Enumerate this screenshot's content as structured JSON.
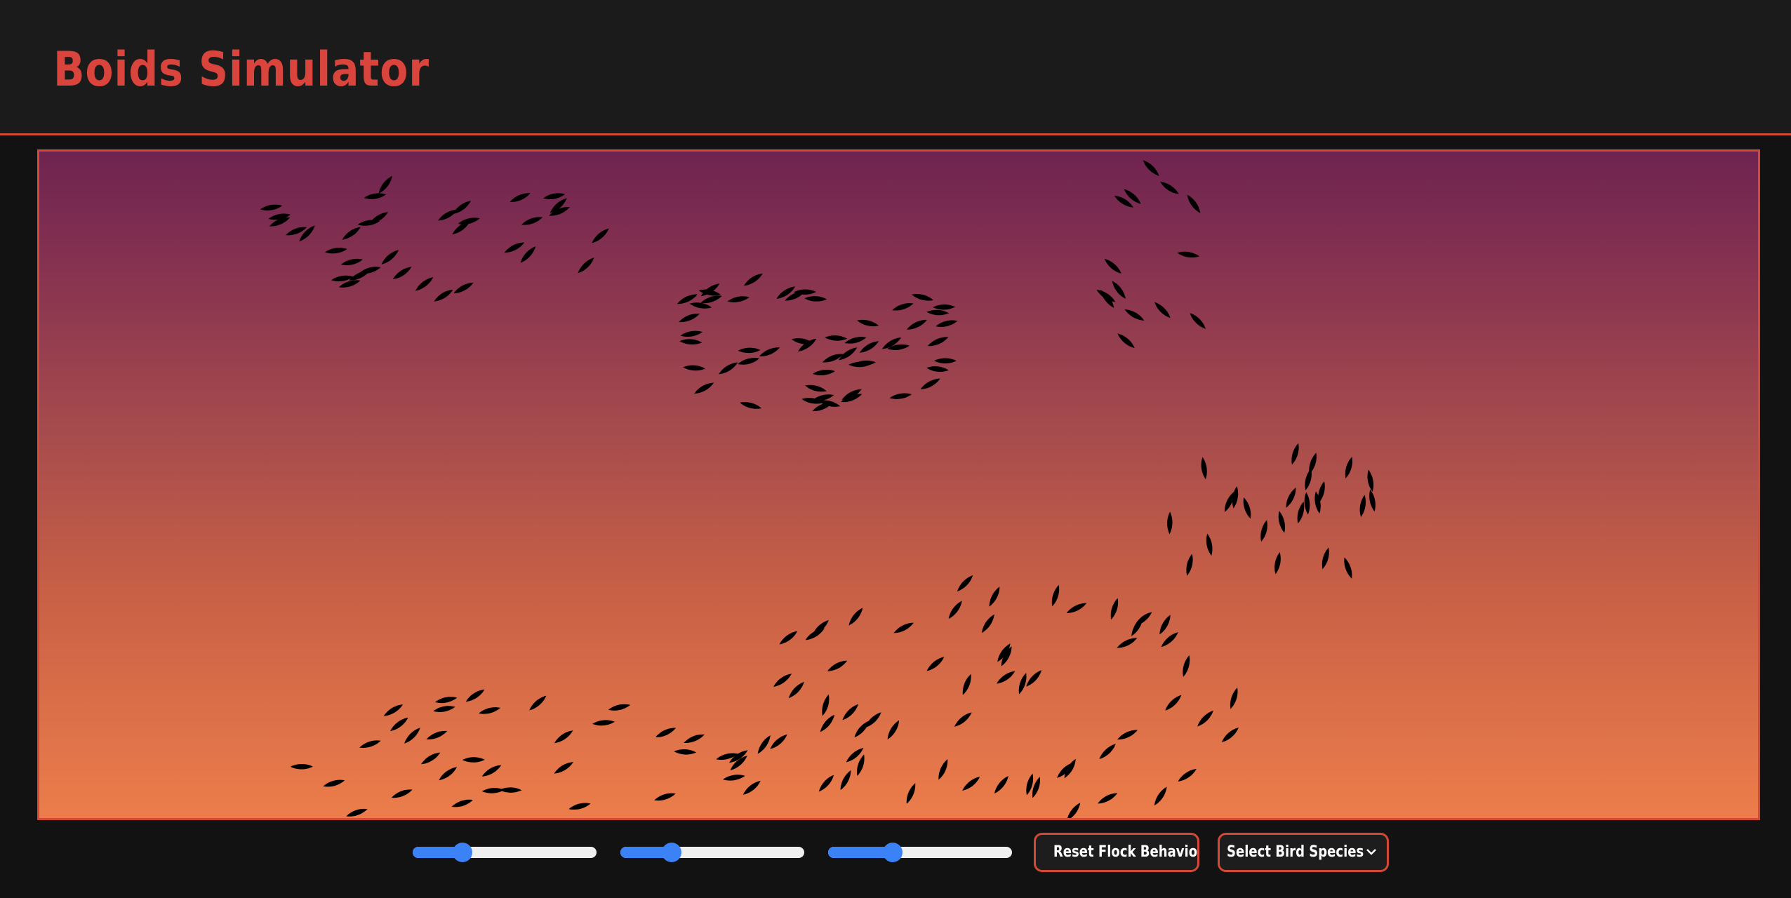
{
  "app": {
    "title": "Boids Simulator"
  },
  "colors": {
    "accent": "#d24a35",
    "title": "#d9443c",
    "header_bg": "#1b1b1b",
    "page_bg": "#121212",
    "sky_top": "#6e2350",
    "sky_bottom": "#ec7d4b",
    "bird": "#000000",
    "slider_fill": "#3b82f6",
    "slider_track": "#efefef"
  },
  "controls": {
    "sliders": [
      {
        "name": "slider-1",
        "value_fraction": 0.27
      },
      {
        "name": "slider-2",
        "value_fraction": 0.28
      },
      {
        "name": "slider-3",
        "value_fraction": 0.35
      }
    ],
    "reset_label": "Reset Flock Behaviour",
    "species_select": {
      "selected_label": "Select Bird Species",
      "icon": "chevron-down-icon"
    }
  },
  "simulation": {
    "bird_shape": "leaf",
    "visible_flocks": 6
  }
}
